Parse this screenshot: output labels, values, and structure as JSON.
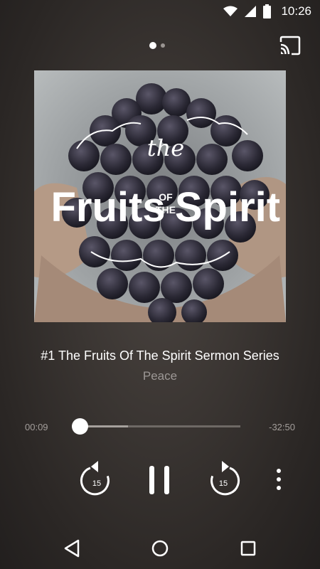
{
  "status_bar": {
    "time": "10:26",
    "icons": [
      "wifi-icon",
      "cellular-signal-icon",
      "battery-icon"
    ]
  },
  "header": {
    "pager_dots": {
      "count": 2,
      "active_index": 0
    },
    "cast_icon": "cast-icon"
  },
  "artwork": {
    "text_the": "the",
    "text_fruits": "Fruits",
    "text_of": "OF",
    "text_the_small": "THE",
    "text_spirit": "Spirit"
  },
  "track": {
    "title": "#1 The Fruits Of The Spirit  Sermon Series",
    "subtitle": "Peace"
  },
  "progress": {
    "elapsed": "00:09",
    "remaining": "-32:50",
    "buffered_fraction": 0.3
  },
  "controls": {
    "rewind_seconds": "15",
    "forward_seconds": "15",
    "play_state": "playing"
  },
  "colors": {
    "background": "#2b2725",
    "text_primary": "#ffffff",
    "text_secondary": "#9d9896"
  }
}
